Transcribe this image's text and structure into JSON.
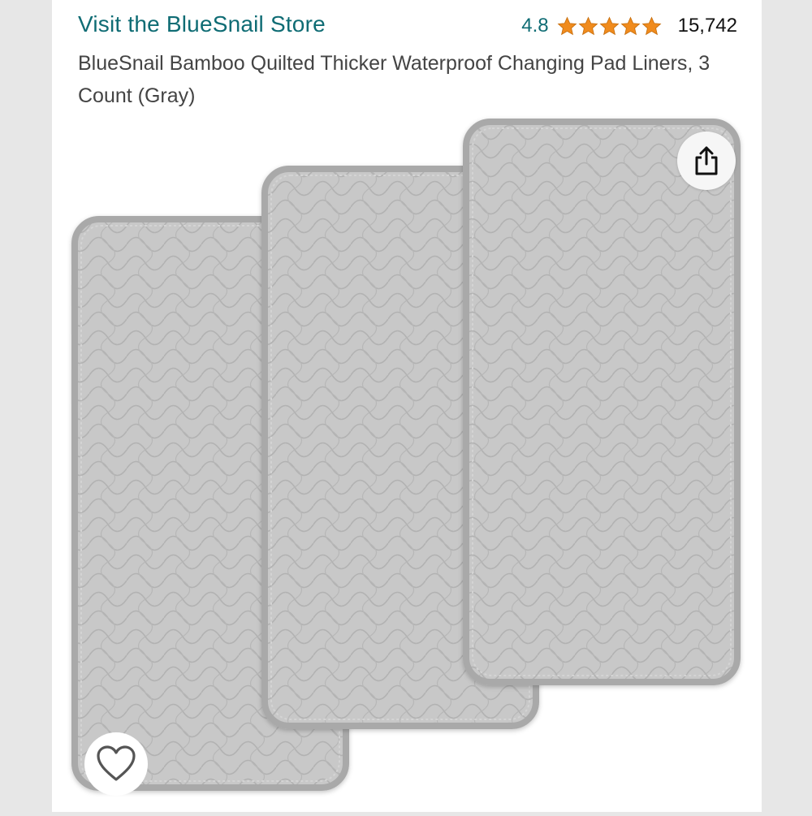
{
  "store": {
    "link_text": "Visit the BlueSnail Store"
  },
  "rating": {
    "value": "4.8",
    "stars": 5,
    "count": "15,742",
    "star_color": "#f08b1d"
  },
  "product": {
    "title": "BlueSnail Bamboo Quilted Thicker Waterproof Changing Pad Liners, 3 Count (Gray)"
  },
  "colors": {
    "link": "#0f6c74",
    "pad_fill": "#c9c9c9",
    "pad_edge": "#b3b3b3",
    "quilt_line": "#b0b0b0"
  },
  "icons": {
    "share": "share-icon",
    "favorite": "heart-icon"
  }
}
